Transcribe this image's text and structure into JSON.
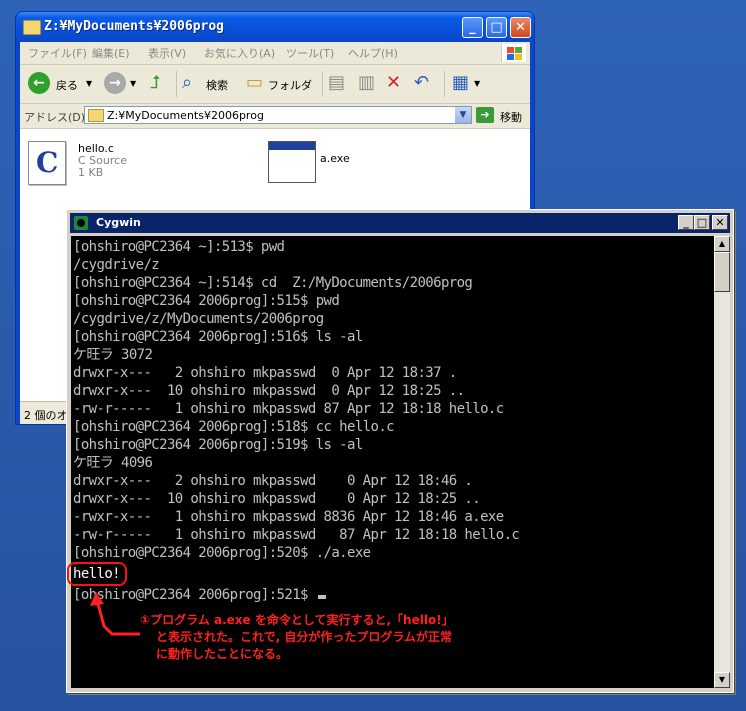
{
  "explorer": {
    "title": "Z:¥MyDocuments¥2006prog",
    "menu": [
      "ファイル(F)",
      "編集(E)",
      "表示(V)",
      "お気に入り(A)",
      "ツール(T)",
      "ヘルプ(H)"
    ],
    "toolbar": {
      "back": "戻る",
      "search": "検索",
      "folder": "フォルダ"
    },
    "address_label": "アドレス(D)",
    "address_value": "Z:¥MyDocuments¥2006prog",
    "go_label": "移動",
    "files": [
      {
        "name": "hello.c",
        "type": "C Source",
        "size": "1 KB"
      },
      {
        "name": "a.exe"
      }
    ],
    "status": "2 個のオ"
  },
  "cygwin": {
    "title": "Cygwin",
    "lines": [
      "[ohshiro@PC2364 ~]:513$ pwd",
      "/cygdrive/z",
      "[ohshiro@PC2364 ~]:514$ cd  Z:/MyDocuments/2006prog",
      "[ohshiro@PC2364 2006prog]:515$ pwd",
      "/cygdrive/z/MyDocuments/2006prog",
      "[ohshiro@PC2364 2006prog]:516$ ls -al",
      "ケ旺ラ 3072",
      "drwxr-x---   2 ohshiro mkpasswd  0 Apr 12 18:37 .",
      "drwxr-x---  10 ohshiro mkpasswd  0 Apr 12 18:25 ..",
      "-rw-r-----   1 ohshiro mkpasswd 87 Apr 12 18:18 hello.c",
      "[ohshiro@PC2364 2006prog]:518$ cc hello.c",
      "[ohshiro@PC2364 2006prog]:519$ ls -al",
      "ケ旺ラ 4096",
      "drwxr-x---   2 ohshiro mkpasswd    0 Apr 12 18:46 .",
      "drwxr-x---  10 ohshiro mkpasswd    0 Apr 12 18:25 ..",
      "-rwxr-x---   1 ohshiro mkpasswd 8836 Apr 12 18:46 a.exe",
      "-rw-r-----   1 ohshiro mkpasswd   87 Apr 12 18:18 hello.c",
      "[ohshiro@PC2364 2006prog]:520$ ./a.exe",
      "hello!",
      "[ohshiro@PC2364 2006prog]:521$ "
    ]
  },
  "annotation": {
    "line1": "①プログラム a.exe を命令として実行すると,「hello!」",
    "line2": "と表示された。これで, 自分が作ったプログラムが正常",
    "line3": "に動作したことになる。"
  },
  "colors": {
    "desktop": "#2a58a8",
    "xp_title": "#0a5ce8",
    "cygwin_title": "#0a246a",
    "terminal_bg": "#000000",
    "terminal_text": "#c0c0c0",
    "annotation": "#ff2020"
  }
}
